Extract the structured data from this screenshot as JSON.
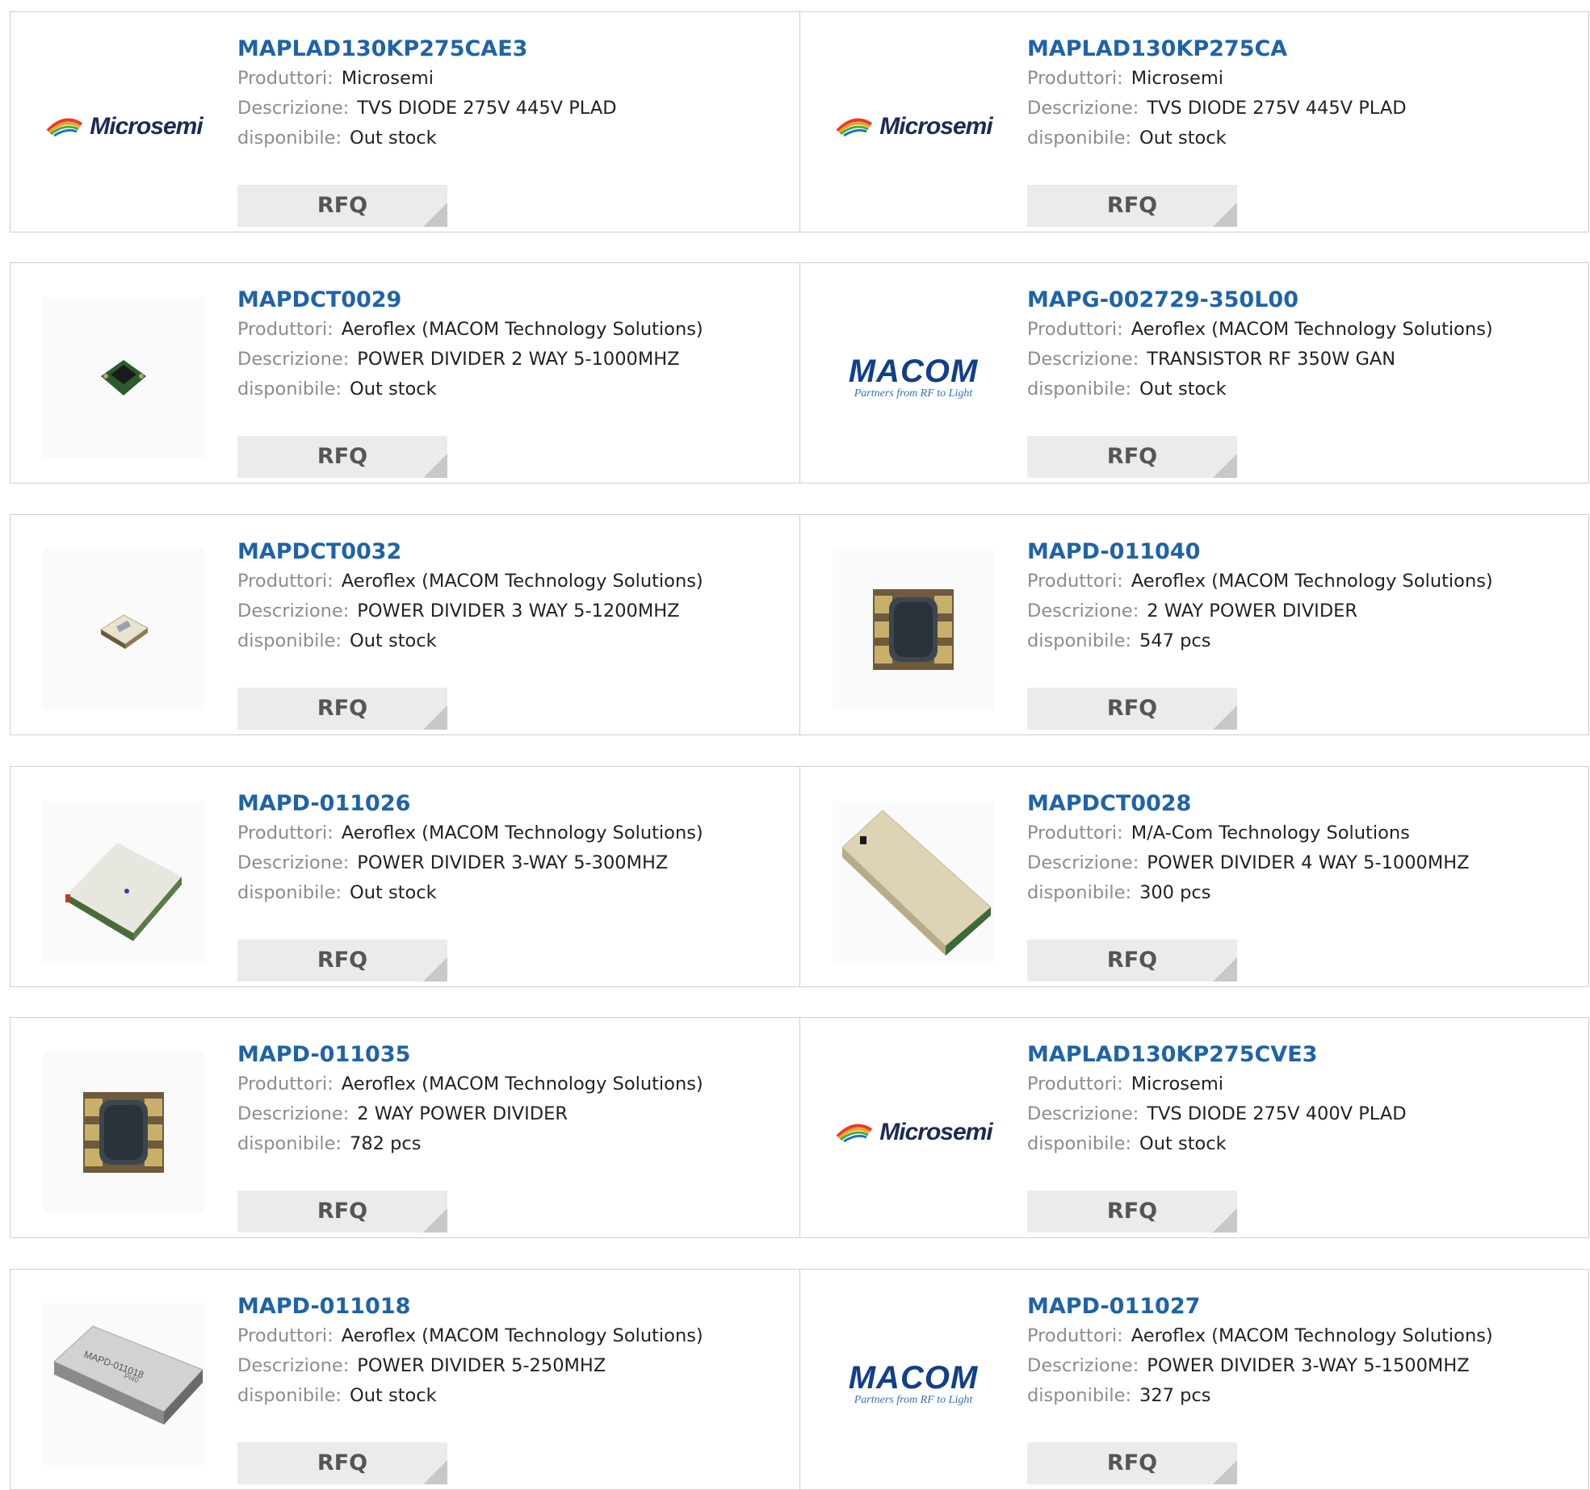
{
  "labels": {
    "manufacturer": "Produttori:",
    "description": "Descrizione:",
    "availability": "disponibile:",
    "rfq": "RFQ"
  },
  "logos": {
    "microsemi": "Microsemi",
    "macom": "MACOM",
    "macom_tagline": "Partners from RF to Light"
  },
  "products": [
    {
      "part": "MAPLAD130KP275CAE3",
      "manufacturer": "Microsemi",
      "description": "TVS DIODE 275V 445V PLAD",
      "availability": "Out stock",
      "image": "microsemi-logo"
    },
    {
      "part": "MAPLAD130KP275CA",
      "manufacturer": "Microsemi",
      "description": "TVS DIODE 275V 445V PLAD",
      "availability": "Out stock",
      "image": "microsemi-logo"
    },
    {
      "part": "MAPDCT0029",
      "manufacturer": "Aeroflex (MACOM Technology Solutions)",
      "description": "POWER DIVIDER 2 WAY 5-1000MHZ",
      "availability": "Out stock",
      "image": "small-green-chip"
    },
    {
      "part": "MAPG-002729-350L00",
      "manufacturer": "Aeroflex (MACOM Technology Solutions)",
      "description": "TRANSISTOR RF 350W GAN",
      "availability": "Out stock",
      "image": "macom-logo"
    },
    {
      "part": "MAPDCT0032",
      "manufacturer": "Aeroflex (MACOM Technology Solutions)",
      "description": "POWER DIVIDER 3 WAY 5-1200MHZ",
      "availability": "Out stock",
      "image": "small-beige-module"
    },
    {
      "part": "MAPD-011040",
      "manufacturer": "Aeroflex (MACOM Technology Solutions)",
      "description": "2 WAY POWER DIVIDER",
      "availability": "547 pcs",
      "image": "qfn-chip"
    },
    {
      "part": "MAPD-011026",
      "manufacturer": "Aeroflex (MACOM Technology Solutions)",
      "description": "POWER DIVIDER 3-WAY 5-300MHZ",
      "availability": "Out stock",
      "image": "white-module"
    },
    {
      "part": "MAPDCT0028",
      "manufacturer": "M/A-Com Technology Solutions",
      "description": "POWER DIVIDER 4 WAY 5-1000MHZ",
      "availability": "300 pcs",
      "image": "beige-module"
    },
    {
      "part": "MAPD-011035",
      "manufacturer": "Aeroflex (MACOM Technology Solutions)",
      "description": "2 WAY POWER DIVIDER",
      "availability": "782 pcs",
      "image": "qfn-chip"
    },
    {
      "part": "MAPLAD130KP275CVE3",
      "manufacturer": "Microsemi",
      "description": "TVS DIODE 275V 400V PLAD",
      "availability": "Out stock",
      "image": "microsemi-logo"
    },
    {
      "part": "MAPD-011018",
      "manufacturer": "Aeroflex (MACOM Technology Solutions)",
      "description": "POWER DIVIDER 5-250MHZ",
      "availability": "Out stock",
      "image": "labeled-module",
      "image_text": "MAPD-011018",
      "image_subtext": "PI40"
    },
    {
      "part": "MAPD-011027",
      "manufacturer": "Aeroflex (MACOM Technology Solutions)",
      "description": "POWER DIVIDER 3-WAY 5-1500MHZ",
      "availability": "327 pcs",
      "image": "macom-logo"
    }
  ]
}
